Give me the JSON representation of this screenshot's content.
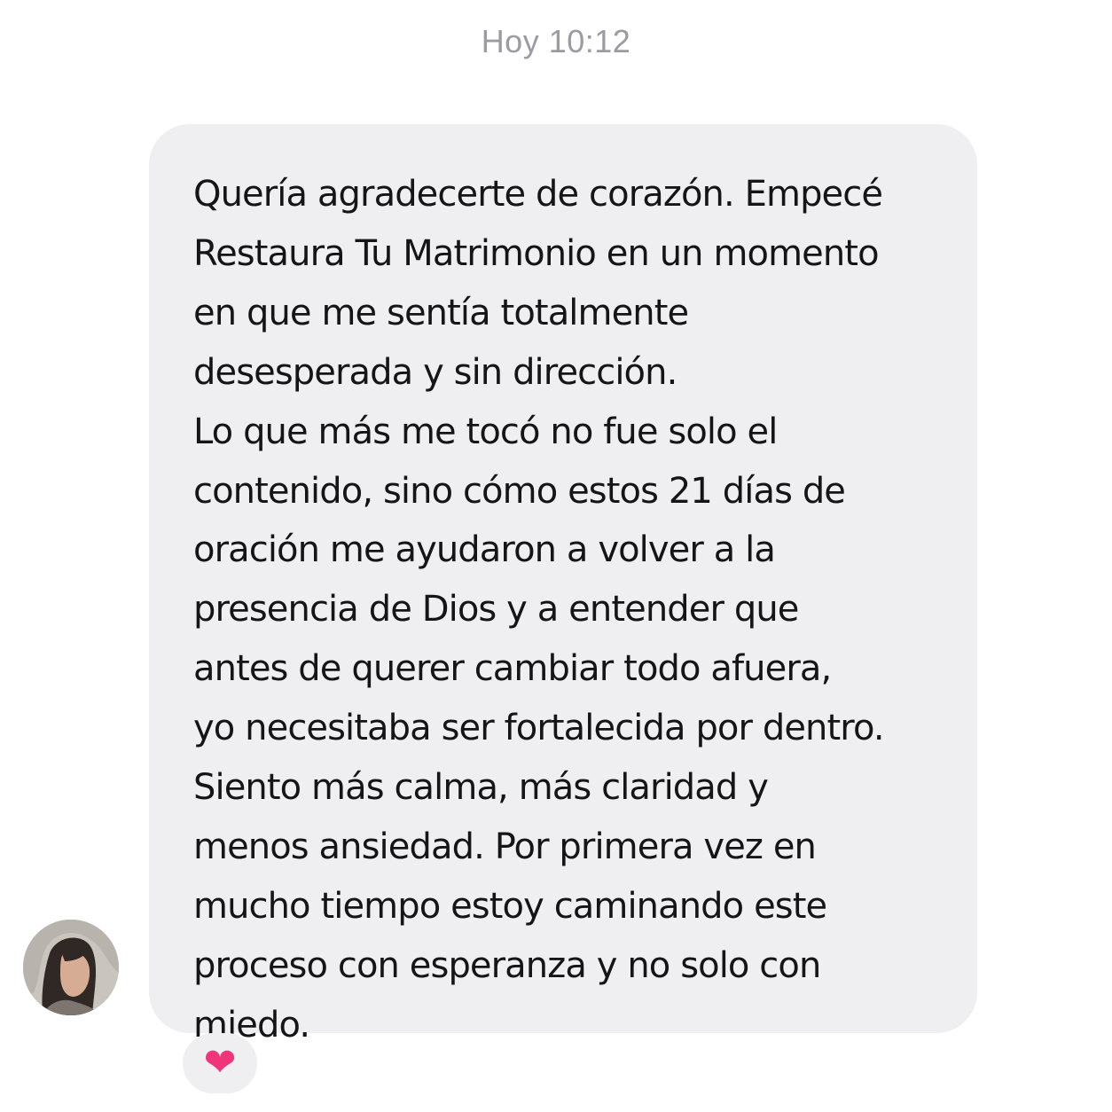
{
  "header": {
    "timestamp": "Hoy 10:12"
  },
  "message": {
    "lines": [
      "Quería agradecerte de corazón. Empecé",
      "Restaura Tu Matrimonio en un momento",
      "en que me sentía totalmente",
      "desesperada y sin dirección.",
      "Lo que más me tocó no fue solo el",
      "contenido, sino cómo estos 21 días de",
      "oración me ayudaron a volver a la",
      "presencia de Dios y a entender que",
      "antes de querer cambiar todo afuera,",
      "yo necesitaba ser fortalecida por dentro.",
      "Siento más calma, más claridad y",
      "menos ansiedad. Por primera vez en",
      "mucho tiempo estoy caminando este",
      "proceso con esperanza y no solo con",
      "miedo."
    ],
    "reaction": {
      "icon": "heart-icon",
      "glyph": "❤",
      "color": "#f0357a"
    }
  },
  "sender": {
    "avatar": "avatar-icon"
  },
  "colors": {
    "bubble_background": "#efeff1",
    "text": "#151515",
    "timestamp": "#9b9ba1"
  }
}
